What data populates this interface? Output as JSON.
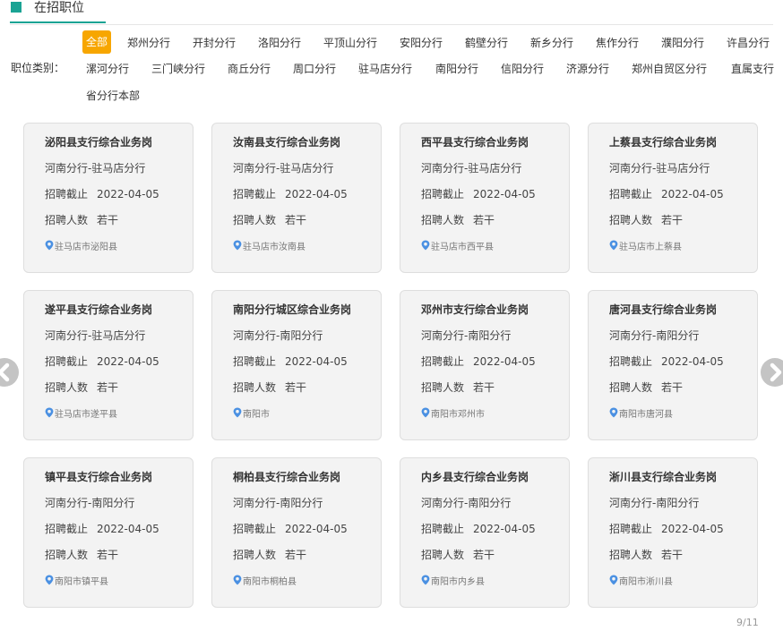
{
  "header": {
    "title": "在招职位"
  },
  "filter": {
    "label": "职位类别：",
    "chips": [
      {
        "label": "全部",
        "active": true
      },
      {
        "label": "郑州分行"
      },
      {
        "label": "开封分行"
      },
      {
        "label": "洛阳分行"
      },
      {
        "label": "平顶山分行"
      },
      {
        "label": "安阳分行"
      },
      {
        "label": "鹤壁分行"
      },
      {
        "label": "新乡分行"
      },
      {
        "label": "焦作分行"
      },
      {
        "label": "濮阳分行"
      },
      {
        "label": "许昌分行"
      },
      {
        "label": "漯河分行"
      },
      {
        "label": "三门峡分行"
      },
      {
        "label": "商丘分行"
      },
      {
        "label": "周口分行"
      },
      {
        "label": "驻马店分行"
      },
      {
        "label": "南阳分行"
      },
      {
        "label": "信阳分行"
      },
      {
        "label": "济源分行"
      },
      {
        "label": "郑州自贸区分行"
      },
      {
        "label": "直属支行"
      },
      {
        "label": "省分行本部"
      }
    ]
  },
  "card_labels": {
    "deadline": "招聘截止",
    "headcount": "招聘人数"
  },
  "jobs": [
    {
      "title": "泌阳县支行综合业务岗",
      "branch": "河南分行-驻马店分行",
      "deadline": "2022-04-05",
      "headcount": "若干",
      "location": "驻马店市泌阳县"
    },
    {
      "title": "汝南县支行综合业务岗",
      "branch": "河南分行-驻马店分行",
      "deadline": "2022-04-05",
      "headcount": "若干",
      "location": "驻马店市汝南县"
    },
    {
      "title": "西平县支行综合业务岗",
      "branch": "河南分行-驻马店分行",
      "deadline": "2022-04-05",
      "headcount": "若干",
      "location": "驻马店市西平县"
    },
    {
      "title": "上蔡县支行综合业务岗",
      "branch": "河南分行-驻马店分行",
      "deadline": "2022-04-05",
      "headcount": "若干",
      "location": "驻马店市上蔡县"
    },
    {
      "title": "遂平县支行综合业务岗",
      "branch": "河南分行-驻马店分行",
      "deadline": "2022-04-05",
      "headcount": "若干",
      "location": "驻马店市遂平县"
    },
    {
      "title": "南阳分行城区综合业务岗",
      "branch": "河南分行-南阳分行",
      "deadline": "2022-04-05",
      "headcount": "若干",
      "location": "南阳市"
    },
    {
      "title": "邓州市支行综合业务岗",
      "branch": "河南分行-南阳分行",
      "deadline": "2022-04-05",
      "headcount": "若干",
      "location": "南阳市邓州市"
    },
    {
      "title": "唐河县支行综合业务岗",
      "branch": "河南分行-南阳分行",
      "deadline": "2022-04-05",
      "headcount": "若干",
      "location": "南阳市唐河县"
    },
    {
      "title": "镇平县支行综合业务岗",
      "branch": "河南分行-南阳分行",
      "deadline": "2022-04-05",
      "headcount": "若干",
      "location": "南阳市镇平县"
    },
    {
      "title": "桐柏县支行综合业务岗",
      "branch": "河南分行-南阳分行",
      "deadline": "2022-04-05",
      "headcount": "若干",
      "location": "南阳市桐柏县"
    },
    {
      "title": "内乡县支行综合业务岗",
      "branch": "河南分行-南阳分行",
      "deadline": "2022-04-05",
      "headcount": "若干",
      "location": "南阳市内乡县"
    },
    {
      "title": "淅川县支行综合业务岗",
      "branch": "河南分行-南阳分行",
      "deadline": "2022-04-05",
      "headcount": "若干",
      "location": "南阳市淅川县"
    }
  ],
  "pager": {
    "text": "9/11"
  },
  "colors": {
    "accent": "#1aa394",
    "active_chip": "#f7a600",
    "pin": "#4a90e2"
  }
}
